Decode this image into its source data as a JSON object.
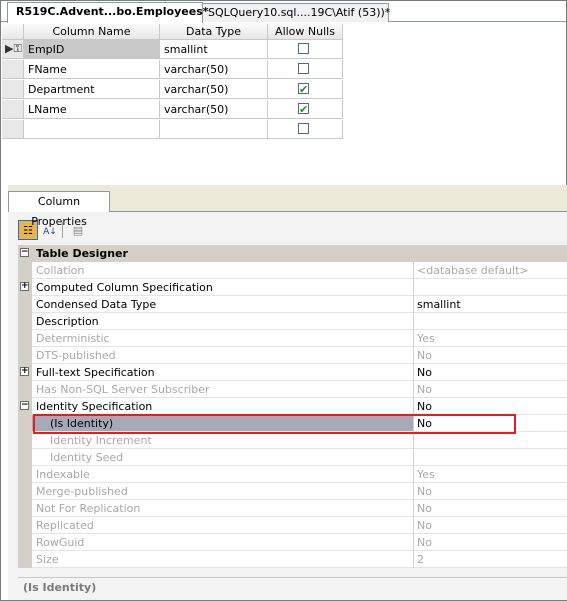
{
  "tabs": [
    {
      "label": "R519C.Advent...bo.Employees*"
    },
    {
      "label": "SQLQuery10.sql....19C\\Atif (53))*"
    }
  ],
  "grid": {
    "headers": {
      "column_name": "Column Name",
      "data_type": "Data Type",
      "allow_nulls": "Allow Nulls"
    },
    "rows": [
      {
        "name": "EmpID",
        "type": "smallint",
        "nulls": false,
        "primary_key": true
      },
      {
        "name": "FName",
        "type": "varchar(50)",
        "nulls": false
      },
      {
        "name": "Department",
        "type": "varchar(50)",
        "nulls": true
      },
      {
        "name": "LName",
        "type": "varchar(50)",
        "nulls": true
      },
      {
        "name": "",
        "type": "",
        "nulls": false
      }
    ]
  },
  "properties": {
    "tab_label": "Column Properties",
    "category": "Table Designer",
    "rows": [
      {
        "name": "Collation",
        "value": "<database default>",
        "disabled": true
      },
      {
        "name": "Computed Column Specification",
        "value": "",
        "expander": "+"
      },
      {
        "name": "Condensed Data Type",
        "value": "smallint"
      },
      {
        "name": "Description",
        "value": ""
      },
      {
        "name": "Deterministic",
        "value": "Yes",
        "disabled": true
      },
      {
        "name": "DTS-published",
        "value": "No",
        "disabled": true
      },
      {
        "name": "Full-text Specification",
        "value": "No",
        "expander": "+"
      },
      {
        "name": "Has Non-SQL Server Subscriber",
        "value": "No",
        "disabled": true
      },
      {
        "name": "Identity Specification",
        "value": "No",
        "expander": "−"
      },
      {
        "name": "(Is Identity)",
        "value": "No",
        "sub": true,
        "selected": true
      },
      {
        "name": "Identity Increment",
        "value": "",
        "sub": true,
        "disabled": true
      },
      {
        "name": "Identity Seed",
        "value": "",
        "sub": true,
        "disabled": true
      },
      {
        "name": "Indexable",
        "value": "Yes",
        "disabled": true
      },
      {
        "name": "Merge-published",
        "value": "No",
        "disabled": true
      },
      {
        "name": "Not For Replication",
        "value": "No",
        "disabled": true
      },
      {
        "name": "Replicated",
        "value": "No",
        "disabled": true
      },
      {
        "name": "RowGuid",
        "value": "No",
        "disabled": true
      },
      {
        "name": "Size",
        "value": "2",
        "disabled": true
      }
    ],
    "description_title": "(Is Identity)"
  },
  "colors": {
    "highlight": "#e02020",
    "checkmark": "#1c8f1c",
    "selected_row": "#a8a8b8"
  }
}
